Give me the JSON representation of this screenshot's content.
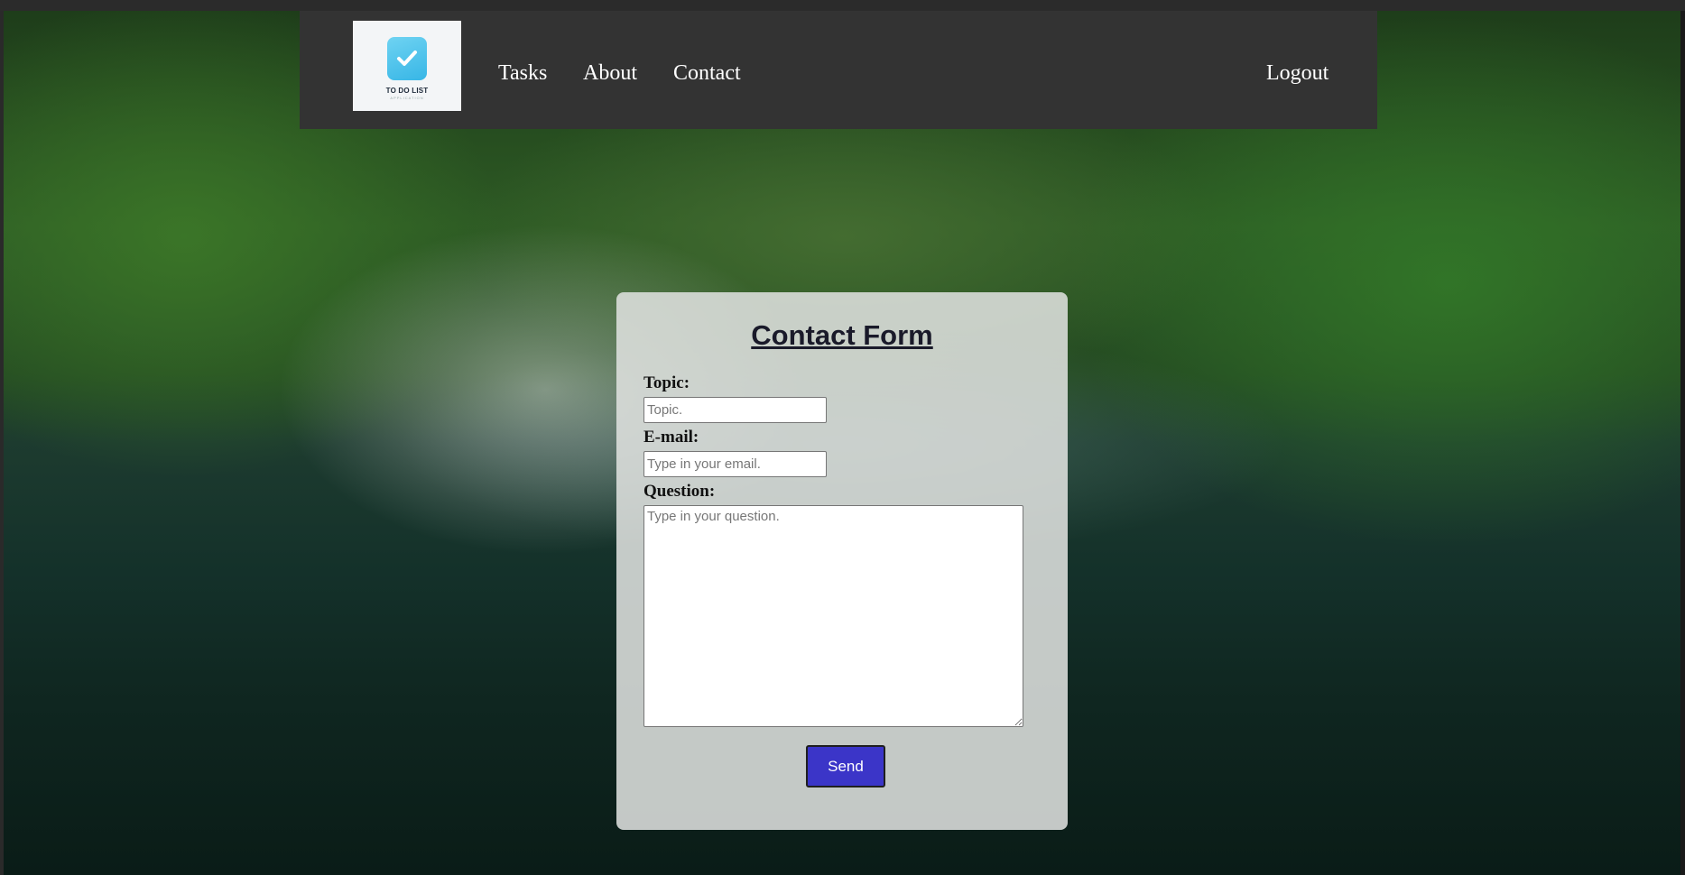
{
  "nav": {
    "logo": {
      "text": "TO DO LIST",
      "subtext": "APPLICATION"
    },
    "links": [
      "Tasks",
      "About",
      "Contact"
    ],
    "logout": "Logout"
  },
  "form": {
    "title": "Contact Form",
    "topic_label": "Topic:",
    "topic_placeholder": "Topic.",
    "email_label": "E-mail:",
    "email_placeholder": "Type in your email.",
    "question_label": "Question:",
    "question_placeholder": "Type in your question.",
    "send_label": "Send"
  },
  "colors": {
    "navbar_bg": "#333333",
    "send_button_bg": "#3b35c8",
    "card_bg": "#dee0de",
    "logo_accent": "#37b6e6"
  },
  "icons": {
    "logo": "checkmark-icon"
  }
}
